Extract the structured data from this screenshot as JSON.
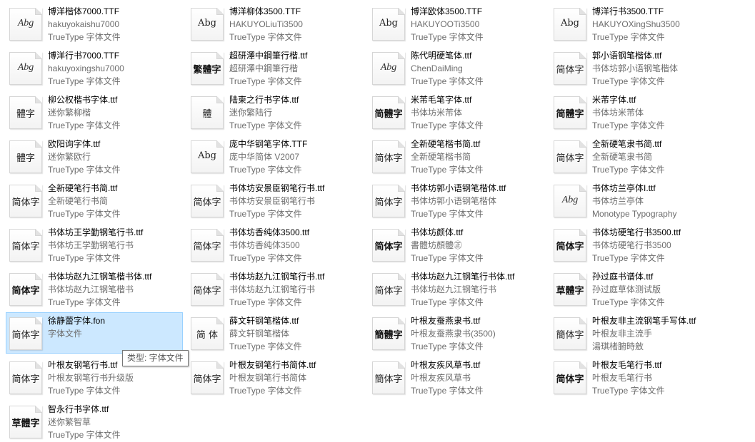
{
  "files": [
    {
      "name": "博洋楷体7000.TTF",
      "line2": "hakuyokaishu7000",
      "line3": "TrueType 字体文件",
      "glyph": "Abg",
      "style": "latin"
    },
    {
      "name": "博洋柳体3500.TTF",
      "line2": "HAKUYOLiuTi3500",
      "line3": "TrueType 字体文件",
      "glyph": "Abg",
      "style": "serif"
    },
    {
      "name": "博洋欧体3500.TTF",
      "line2": "HAKUYOOTi3500",
      "line3": "TrueType 字体文件",
      "glyph": "Abg",
      "style": "serif"
    },
    {
      "name": "博洋行书3500.TTF",
      "line2": "HAKUYOXingShu3500",
      "line3": "TrueType 字体文件",
      "glyph": "Abg",
      "style": "serif"
    },
    {
      "name": "博洋行书7000.TTF",
      "line2": "hakuyoxingshu7000",
      "line3": "TrueType 字体文件",
      "glyph": "Abg",
      "style": "latin"
    },
    {
      "name": "超研澤中鋼筆行楷.ttf",
      "line2": "超研澤中鋼筆行楷",
      "line3": "TrueType 字体文件",
      "glyph": "繁體字",
      "style": "bold"
    },
    {
      "name": "陈代明硬笔体.ttf",
      "line2": "ChenDaiMing",
      "line3": "TrueType 字体文件",
      "glyph": "Abg",
      "style": "latin"
    },
    {
      "name": "郭小语钢笔楷体.ttf",
      "line2": "书体坊郭小语钢笔楷体",
      "line3": "TrueType 字体文件",
      "glyph": "简体字",
      "style": "serif"
    },
    {
      "name": "柳公权楷书字体.ttf",
      "line2": "迷你繁柳楷",
      "line3": "TrueType 字体文件",
      "glyph": "體字",
      "style": "serif"
    },
    {
      "name": "陆柬之行书字体.ttf",
      "line2": "迷你繁陆行",
      "line3": "TrueType 字体文件",
      "glyph": "體",
      "style": "serif"
    },
    {
      "name": "米芾毛笔字体.ttf",
      "line2": "书体坊米芾体",
      "line3": "TrueType 字体文件",
      "glyph": "简體字",
      "style": "bold"
    },
    {
      "name": "米芾字体.ttf",
      "line2": "书体坊米芾体",
      "line3": "TrueType 字体文件",
      "glyph": "简體字",
      "style": "bold"
    },
    {
      "name": "欧阳询字体.ttf",
      "line2": "迷你繁欧行",
      "line3": "TrueType 字体文件",
      "glyph": "體字",
      "style": "serif"
    },
    {
      "name": "庞中华钢笔字体.TTF",
      "line2": "庞中华简体 V2007",
      "line3": "TrueType 字体文件",
      "glyph": "Abg",
      "style": "serif"
    },
    {
      "name": "全新硬笔楷书简.ttf",
      "line2": "全新硬笔楷书简",
      "line3": "TrueType 字体文件",
      "glyph": "简体字",
      "style": "serif"
    },
    {
      "name": "全新硬笔隶书简.ttf",
      "line2": "全新硬笔隶书简",
      "line3": "TrueType 字体文件",
      "glyph": "简体字",
      "style": "serif"
    },
    {
      "name": "全新硬笔行书简.ttf",
      "line2": "全新硬笔行书简",
      "line3": "TrueType 字体文件",
      "glyph": "简体字",
      "style": "serif"
    },
    {
      "name": "书体坊安景臣钢笔行书.ttf",
      "line2": "书体坊安景臣钢笔行书",
      "line3": "TrueType 字体文件",
      "glyph": "简体字",
      "style": "serif"
    },
    {
      "name": "书体坊郭小语钢笔楷体.ttf",
      "line2": "书体坊郭小语钢笔楷体",
      "line3": "TrueType 字体文件",
      "glyph": "简体字",
      "style": "serif"
    },
    {
      "name": "书体坊兰亭体I.ttf",
      "line2": "书体坊兰亭体",
      "line3": "Monotype Typography",
      "glyph": "Abg",
      "style": "latin"
    },
    {
      "name": "书体坊王学勤钢笔行书.ttf",
      "line2": "书体坊王学勤钢笔行书",
      "line3": "TrueType 字体文件",
      "glyph": "简体字",
      "style": "serif"
    },
    {
      "name": "书体坊香纯体3500.ttf",
      "line2": "书体坊香纯体3500",
      "line3": "TrueType 字体文件",
      "glyph": "简体字",
      "style": "serif"
    },
    {
      "name": "书体坊颜体.ttf",
      "line2": "書體坊顏體㊣",
      "line3": "TrueType 字体文件",
      "glyph": "简体字",
      "style": "bold"
    },
    {
      "name": "书体坊硬笔行书3500.ttf",
      "line2": "书体坊硬笔行书3500",
      "line3": "TrueType 字体文件",
      "glyph": "简体字",
      "style": "bold"
    },
    {
      "name": "书体坊赵九江钢笔楷书体.ttf",
      "line2": "书体坊赵九江钢笔楷书",
      "line3": "TrueType 字体文件",
      "glyph": "简体字",
      "style": "bold"
    },
    {
      "name": "书体坊赵九江钢笔行书.ttf",
      "line2": "书体坊赵九江钢笔行书",
      "line3": "TrueType 字体文件",
      "glyph": "简体字",
      "style": "serif"
    },
    {
      "name": "书体坊赵九江钢笔行书体.ttf",
      "line2": "书体坊赵九江钢笔行书",
      "line3": "TrueType 字体文件",
      "glyph": "简体字",
      "style": "serif"
    },
    {
      "name": "孙过庭书谱体.ttf",
      "line2": "孙过庭草体测试版",
      "line3": "TrueType 字体文件",
      "glyph": "草體字",
      "style": "bold"
    },
    {
      "name": "徐静蕾字体.fon",
      "line2": "字体文件",
      "line3": "",
      "glyph": "简体字",
      "style": "serif",
      "selected": true
    },
    {
      "name": "薛文轩钢笔楷体.ttf",
      "line2": "薛文轩钢笔楷体",
      "line3": "TrueType 字体文件",
      "glyph": "简 体",
      "style": "serif"
    },
    {
      "name": "叶根友蚕燕隶书.ttf",
      "line2": "叶根友蚕燕隶书(3500)",
      "line3": "TrueType 字体文件",
      "glyph": "簡體字",
      "style": "bold"
    },
    {
      "name": "叶根友非主流钢笔手写体.ttf",
      "line2": "叶根友非主流手",
      "line3": "湯琪楮腑時敫",
      "glyph": "簡体字",
      "style": "serif"
    },
    {
      "name": "叶根友钢笔行书.ttf",
      "line2": "叶根友钢笔行书升级版",
      "line3": "TrueType 字体文件",
      "glyph": "简体字",
      "style": "serif"
    },
    {
      "name": "叶根友钢笔行书简体.ttf",
      "line2": "叶根友钢笔行书简体",
      "line3": "TrueType 字体文件",
      "glyph": "简体字",
      "style": "serif"
    },
    {
      "name": "叶根友疾风草书.ttf",
      "line2": "叶根友疾风草书",
      "line3": "TrueType 字体文件",
      "glyph": "簡体字",
      "style": "serif"
    },
    {
      "name": "叶根友毛笔行书.ttf",
      "line2": "叶根友毛笔行书",
      "line3": "TrueType 字体文件",
      "glyph": "简体字",
      "style": "bold"
    },
    {
      "name": "智永行书字体.ttf",
      "line2": "迷你繁智草",
      "line3": "TrueType 字体文件",
      "glyph": "草體字",
      "style": "bold"
    }
  ],
  "tooltip": "类型: 字体文件"
}
